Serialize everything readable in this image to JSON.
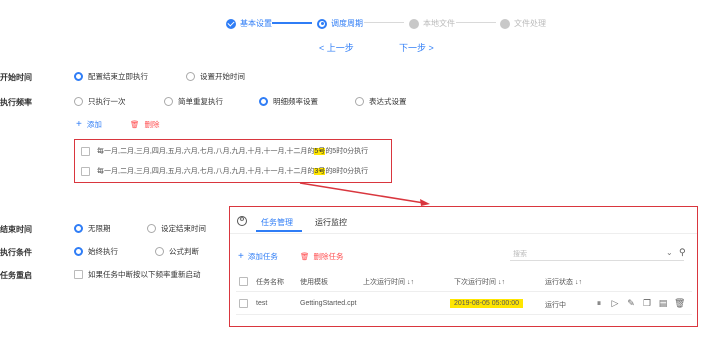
{
  "stepper": {
    "steps": [
      {
        "label": "基本设置",
        "state": "done"
      },
      {
        "label": "调度周期",
        "state": "current"
      },
      {
        "label": "本地文件",
        "state": "pending"
      },
      {
        "label": "文件处理",
        "state": "pending"
      }
    ],
    "prev": "< 上一步",
    "next": "下一步 >"
  },
  "form": {
    "start_time": {
      "label": "开始时间",
      "options": [
        "配置结束立即执行",
        "设置开始时间"
      ],
      "selected": 0
    },
    "frequency": {
      "label": "执行频率",
      "options": [
        "只执行一次",
        "简单重复执行",
        "明细频率设置",
        "表达式设置"
      ],
      "selected": 2,
      "add": "添加",
      "delete": "删除",
      "rows": [
        {
          "pre": "每一月,二月,三月,四月,五月,六月,七月,八月,九月,十月,十一月,十二月的",
          "hl": "5号",
          "post": "的5时0分执行"
        },
        {
          "pre": "每一月,二月,三月,四月,五月,六月,七月,八月,九月,十月,十一月,十二月的",
          "hl": "3号",
          "post": "的8时0分执行"
        }
      ]
    },
    "end_time": {
      "label": "结束时间",
      "options": [
        "无限期",
        "设定结束时间"
      ],
      "selected": 0
    },
    "condition": {
      "label": "执行条件",
      "options": [
        "始终执行",
        "公式判断"
      ],
      "selected": 0
    },
    "restart": {
      "label": "任务重启",
      "checkbox": "如果任务中断按以下频率重新启动"
    }
  },
  "panel": {
    "tabs": [
      "任务管理",
      "运行监控"
    ],
    "add_task": "添加任务",
    "delete_task": "删除任务",
    "search_placeholder": "搜索",
    "headers": [
      "任务名称",
      "使用模板",
      "上次运行时间 ↓↑",
      "下次运行时间 ↓↑",
      "运行状态 ↓↑"
    ],
    "row": {
      "name": "test",
      "template": "GettingStarted.cpt",
      "last_run": "",
      "next_run": "2019-08-05 05:00:00",
      "status": "运行中"
    }
  },
  "colors": {
    "accent": "#2f7df6",
    "highlight": "#ffe600",
    "annotation": "#d9363e",
    "danger": "#ff4d4f"
  }
}
